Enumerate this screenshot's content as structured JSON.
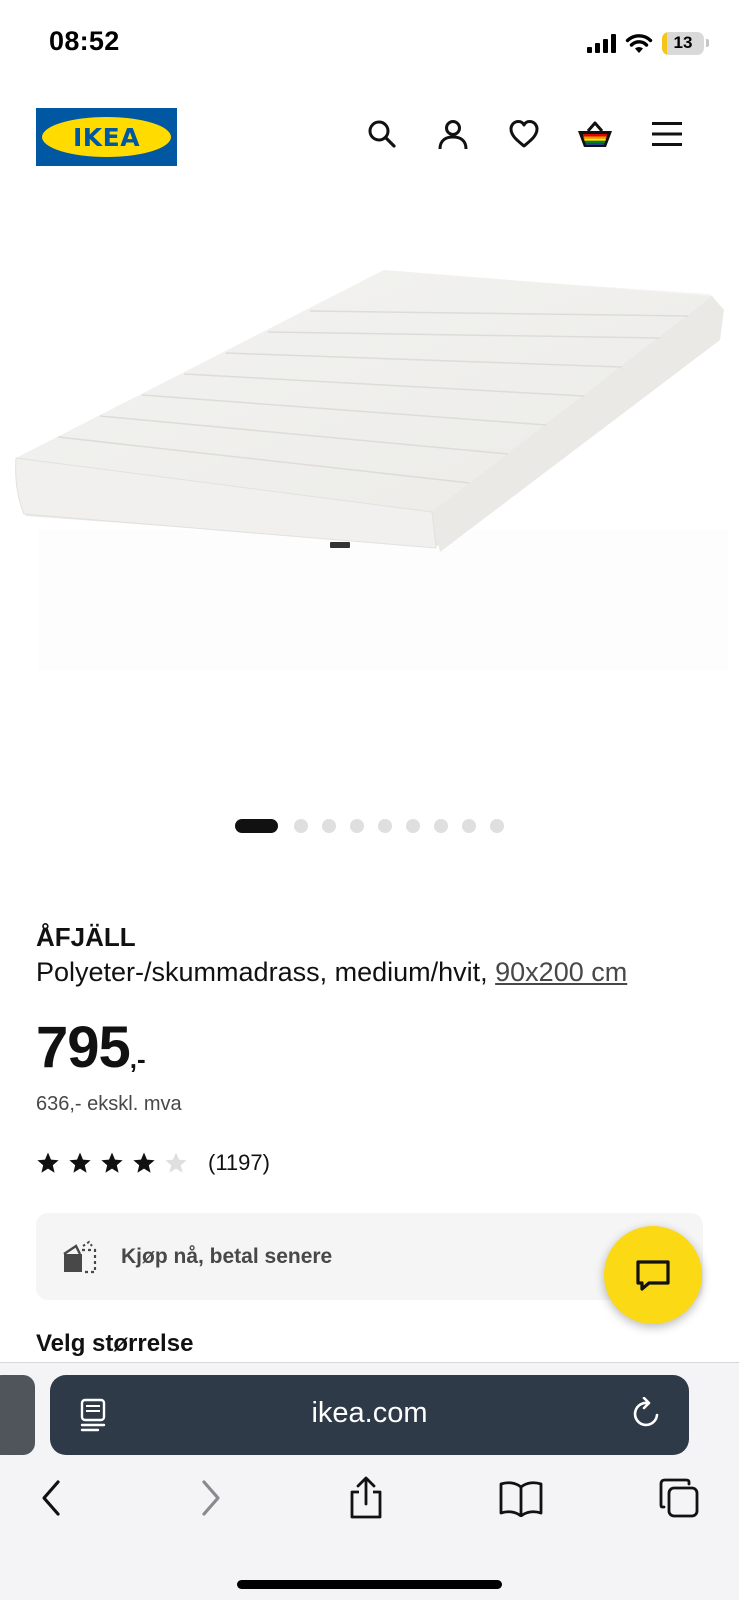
{
  "status_bar": {
    "time": "08:52",
    "battery": "13",
    "battery_level": 0.13
  },
  "header": {
    "logo": "IKEA",
    "icons": [
      "search-icon",
      "user-icon",
      "heart-icon",
      "basket-icon",
      "menu-icon"
    ],
    "brand_colors": {
      "blue": "#0058a3",
      "yellow": "#ffdb00"
    }
  },
  "gallery": {
    "image_count": 9,
    "active_index": 0
  },
  "product": {
    "name": "ÅFJÄLL",
    "description": "Polyeter-/skummadrass, medium/hvit, ",
    "size": "90x200 cm",
    "price": "795",
    "price_suffix": ",-",
    "price_ex_vat": "636,- ekskl. mva",
    "rating": 4,
    "rating_max": 5,
    "review_count": "(1197)"
  },
  "bnpl": {
    "label": "Kjøp nå, betal senere"
  },
  "chat": {
    "icon": "chat-icon",
    "color": "#fbd914"
  },
  "size_section": {
    "heading": "Velg størrelse"
  },
  "browser": {
    "url": "ikea.com",
    "toolbar_icons": [
      "back-icon",
      "forward-icon",
      "share-icon",
      "bookmarks-icon",
      "tabs-icon"
    ]
  }
}
